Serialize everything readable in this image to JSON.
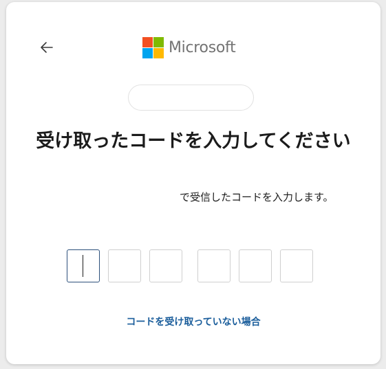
{
  "header": {
    "back_icon": "arrow-left-icon",
    "logo_text": "Microsoft",
    "logo_colors": [
      "#f25022",
      "#7fba00",
      "#00a4ef",
      "#ffb900"
    ]
  },
  "identity": {
    "value": ""
  },
  "main": {
    "title": "受け取ったコードを入力してください",
    "description": "で受信したコードを入力します。",
    "code_digits": [
      "",
      "",
      "",
      "",
      "",
      ""
    ],
    "resend_link": "コードを受け取っていない場合"
  },
  "colors": {
    "link": "#1a5d9b",
    "active_border": "#2b4f7a",
    "text": "#1b1b1b"
  }
}
